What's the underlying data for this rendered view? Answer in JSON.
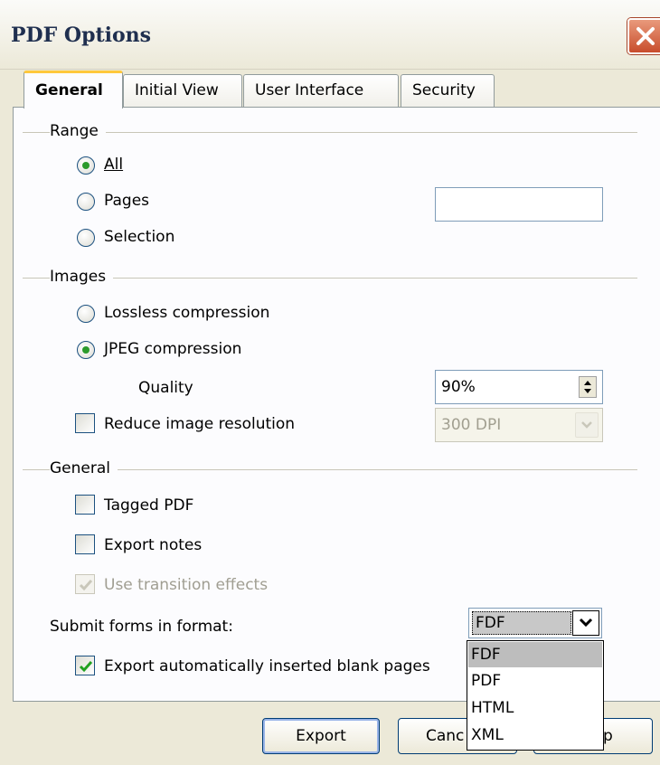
{
  "window": {
    "title": "PDF Options"
  },
  "tabs": [
    {
      "label": "General"
    },
    {
      "label": "Initial View"
    },
    {
      "label": "User Interface"
    },
    {
      "label": "Security"
    }
  ],
  "range": {
    "heading": "Range",
    "all_label": "All",
    "pages_label": "Pages",
    "selection_label": "Selection",
    "pages_value": "",
    "selected": "All"
  },
  "images": {
    "heading": "Images",
    "lossless_label": "Lossless compression",
    "jpeg_label": "JPEG compression",
    "selected": "JPEG compression",
    "quality_label": "Quality",
    "quality_value": "90%",
    "reduce_label": "Reduce image resolution",
    "reduce_checked": false,
    "resolution_value": "300 DPI"
  },
  "general": {
    "heading": "General",
    "tagged_label": "Tagged PDF",
    "tagged_checked": false,
    "notes_label": "Export notes",
    "notes_checked": false,
    "transition_label": "Use transition effects",
    "transition_checked": true,
    "submit_label": "Submit forms in format:",
    "submit_value": "FDF",
    "submit_options": [
      "FDF",
      "PDF",
      "HTML",
      "XML"
    ],
    "blank_label": "Export automatically inserted blank pages",
    "blank_checked": true
  },
  "buttons": {
    "export": "Export",
    "cancel_visible": "Canc",
    "help_visible": "p"
  },
  "colors": {
    "title_text": "#1f2f4f",
    "tab_highlight": "#ffc83c",
    "dialog_bg": "#ece9d8",
    "radio_dot": "#2b9a2b",
    "check_mark": "#21a121",
    "close_button": "#c84d2c"
  }
}
